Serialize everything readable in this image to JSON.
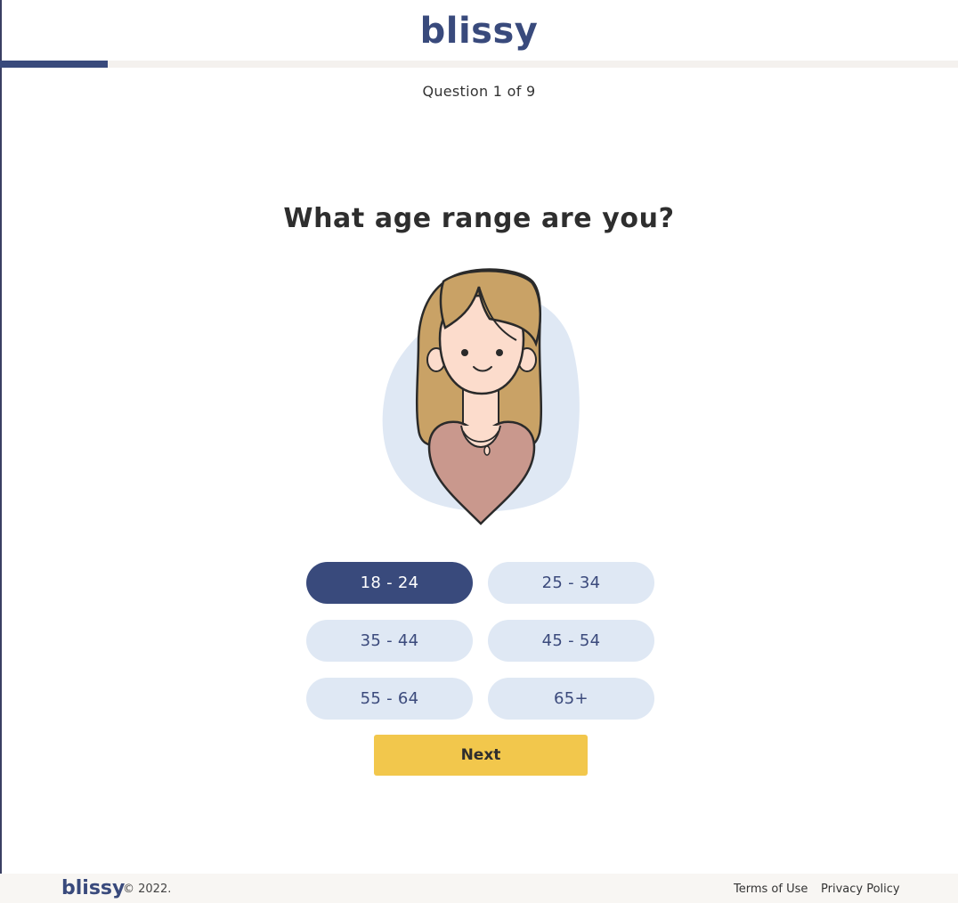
{
  "header": {
    "logo_text": "blissy"
  },
  "progress": {
    "current": 1,
    "total": 9,
    "fraction": 0.112
  },
  "question": {
    "counter_text": "Question 1 of 9",
    "title": "What age range are you?"
  },
  "options": [
    {
      "label": "18 - 24",
      "selected": true
    },
    {
      "label": "25 - 34",
      "selected": false
    },
    {
      "label": "35 - 44",
      "selected": false
    },
    {
      "label": "45 - 54",
      "selected": false
    },
    {
      "label": "55 - 64",
      "selected": false
    },
    {
      "label": "65+",
      "selected": false
    }
  ],
  "next_button": {
    "label": "Next"
  },
  "footer": {
    "logo_text": "blissy",
    "copyright": "© 2022.",
    "terms_label": "Terms of Use",
    "privacy_label": "Privacy Policy"
  },
  "colors": {
    "brand": "#394a7c",
    "option_bg": "#dfe8f4",
    "next_bg": "#f2c74c",
    "progress_track": "#f4f1ee"
  },
  "icons": {
    "illustration": "woman-avatar-illustration"
  }
}
